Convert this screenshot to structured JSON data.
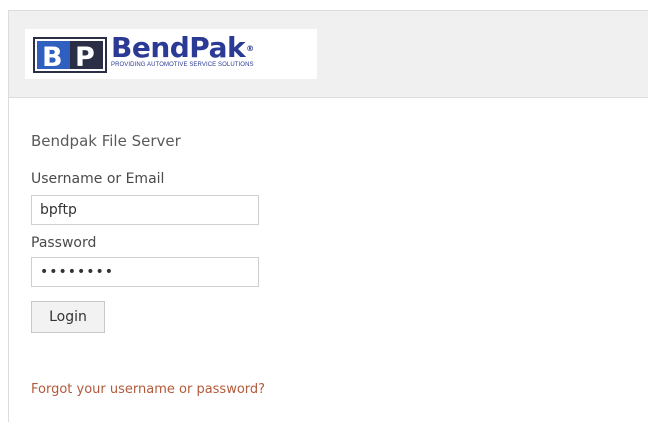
{
  "logo": {
    "mark": "BP",
    "brand": "BendPak",
    "registered": "®",
    "tagline": "PROVIDING AUTOMOTIVE SERVICE SOLUTIONS",
    "colors": {
      "navy": "#2b3a94",
      "blue": "#2f5fbf",
      "dark": "#2b2f45"
    }
  },
  "page": {
    "title": "Bendpak File Server"
  },
  "form": {
    "username_label": "Username or Email",
    "username_value": "bpftp",
    "password_label": "Password",
    "password_value": "bpftp123",
    "login_label": "Login",
    "forgot_link": "Forgot your username or password?"
  },
  "colors": {
    "header_bg": "#f0f0f0",
    "link": "#b35a3a",
    "button_bg": "#f2f2f2"
  }
}
